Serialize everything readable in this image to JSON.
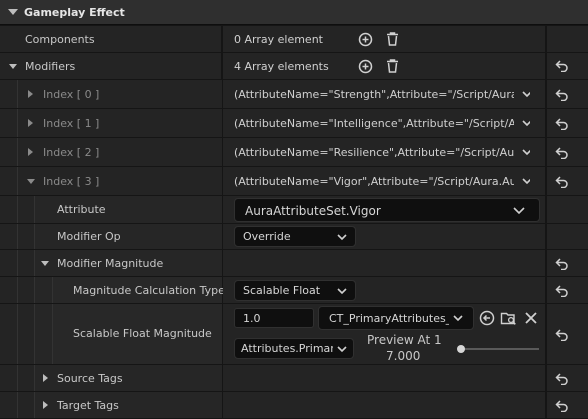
{
  "section": {
    "title": "Gameplay Effect"
  },
  "components": {
    "label": "Components",
    "value": "0 Array element"
  },
  "modifiers": {
    "label": "Modifiers",
    "value": "4 Array elements",
    "indexes": [
      {
        "label": "Index [ 0 ]",
        "value": "(AttributeName=\"Strength\",Attribute=\"/Script/Aura.Au"
      },
      {
        "label": "Index [ 1 ]",
        "value": "(AttributeName=\"Intelligence\",Attribute=\"/Script/Aura"
      },
      {
        "label": "Index [ 2 ]",
        "value": "(AttributeName=\"Resilience\",Attribute=\"/Script/Aura."
      },
      {
        "label": "Index [ 3 ]",
        "value": "(AttributeName=\"Vigor\",Attribute=\"/Script/Aura.AuraA"
      }
    ]
  },
  "attribute": {
    "label": "Attribute",
    "value": "AuraAttributeSet.Vigor"
  },
  "modifier_op": {
    "label": "Modifier Op",
    "value": "Override"
  },
  "modifier_magnitude": {
    "label": "Modifier Magnitude"
  },
  "calc_type": {
    "label": "Magnitude Calculation Type",
    "value": "Scalable Float"
  },
  "scalable_float": {
    "label": "Scalable Float Magnitude",
    "value": "1.0",
    "curve_table": "CT_PrimaryAttributes_E",
    "row_name": "Attributes.Primar",
    "preview_label": "Preview At 1",
    "preview_value": "7.000",
    "preview_level": 0.02
  },
  "source_tags": {
    "label": "Source Tags"
  },
  "target_tags": {
    "label": "Target Tags"
  },
  "icons": {
    "add": "add-icon",
    "delete": "trash-icon",
    "reset": "reset-arrow-icon",
    "browse": "use-selected-icon",
    "folder": "browse-folder-icon",
    "clear": "clear-icon"
  },
  "colors": {
    "background": "#151515",
    "row": "#242424",
    "field": "#0f0f0f",
    "header": "#2f2f2f",
    "text": "#c8c8c8"
  }
}
